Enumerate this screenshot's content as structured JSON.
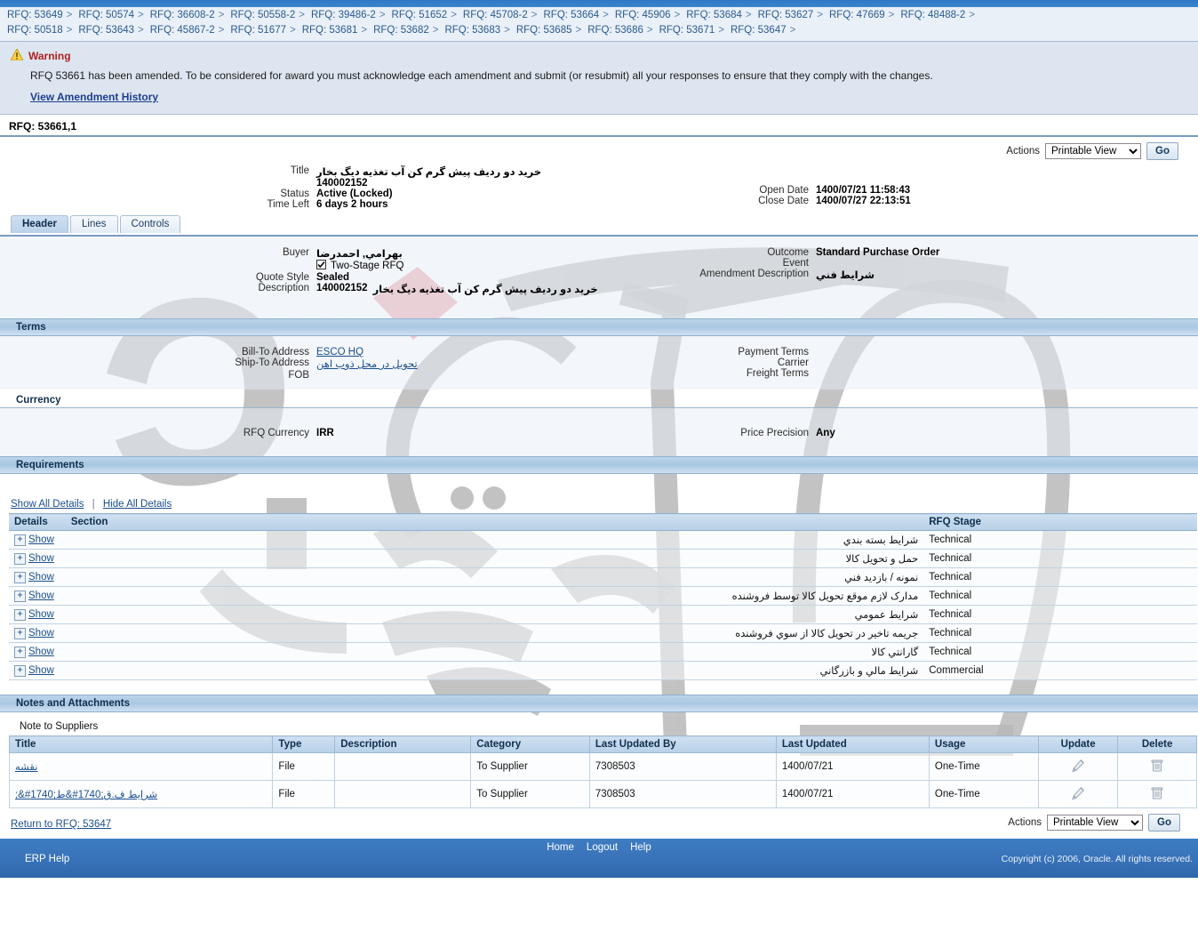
{
  "breadcrumb": {
    "row1": [
      "RFQ: 53649",
      "RFQ: 50574",
      "RFQ: 36608-2",
      "RFQ: 50558-2",
      "RFQ: 39486-2",
      "RFQ: 51652",
      "RFQ: 45708-2",
      "RFQ: 53664",
      "RFQ: 45906",
      "RFQ: 53684",
      "RFQ: 53627",
      "RFQ: 47669",
      "RFQ: 48488-2"
    ],
    "row2": [
      "RFQ: 50518",
      "RFQ: 53643",
      "RFQ: 45867-2",
      "RFQ: 51677",
      "RFQ: 53681",
      "RFQ: 53682",
      "RFQ: 53683",
      "RFQ: 53685",
      "RFQ: 53686",
      "RFQ: 53671",
      "RFQ: 53647"
    ],
    "separator": ">"
  },
  "warning": {
    "icon": "warning-triangle-icon",
    "title": "Warning",
    "message": "RFQ 53661 has been amended. To be considered for award you must acknowledge each amendment and submit (or resubmit) all your responses to ensure that they comply with the changes.",
    "link": "View Amendment History",
    "title_color": "#b02020"
  },
  "page": {
    "rfq_heading": "RFQ: 53661,1"
  },
  "actions_top": {
    "label": "Actions",
    "selected": "Printable View",
    "options": [
      "Printable View"
    ],
    "go": "Go"
  },
  "actions_bottom": {
    "label": "Actions",
    "selected": "Printable View",
    "options": [
      "Printable View"
    ],
    "go": "Go"
  },
  "summary": {
    "title_label": "Title",
    "title_value_ar": "خرید دو ردیف پیش گرم کن آب تغذیه دیگ بخار",
    "title_value_num": "140002152",
    "status_label": "Status",
    "status_value": "Active (Locked)",
    "time_left_label": "Time Left",
    "time_left_value": "6 days 2 hours",
    "open_date_label": "Open Date",
    "open_date_value": "1400/07/21 11:58:43",
    "close_date_label": "Close Date",
    "close_date_value": "1400/07/27 22:13:51"
  },
  "tabs": [
    {
      "label": "Header",
      "active": true
    },
    {
      "label": "Lines",
      "active": false
    },
    {
      "label": "Controls",
      "active": false
    }
  ],
  "header_section": {
    "buyer_label": "Buyer",
    "buyer_value": "بهرامي, احمدرضا",
    "two_stage_label": "Two-Stage RFQ",
    "two_stage_checked": true,
    "quote_style_label": "Quote Style",
    "quote_style_value": "Sealed",
    "description_label": "Description",
    "description_value_ar": "خرید دو ردیف پیش گرم کن آب تغذیه دیگ بخار",
    "description_value_num": "140002152",
    "outcome_label": "Outcome",
    "outcome_value": "Standard Purchase Order",
    "event_label": "Event",
    "event_value": "",
    "amendment_desc_label": "Amendment Description",
    "amendment_desc_value": "شرایط فني"
  },
  "terms": {
    "section_title": "Terms",
    "bill_to_label": "Bill-To Address",
    "bill_to_value": "ESCO HQ",
    "ship_to_label": "Ship-To Address",
    "ship_to_value": "تحویل در محل ذوب اهن",
    "fob_label": "FOB",
    "fob_value": "",
    "payment_terms_label": "Payment Terms",
    "payment_terms_value": "",
    "carrier_label": "Carrier",
    "carrier_value": "",
    "freight_terms_label": "Freight Terms",
    "freight_terms_value": ""
  },
  "currency": {
    "section_title": "Currency",
    "rfq_currency_label": "RFQ Currency",
    "rfq_currency_value": "IRR",
    "price_precision_label": "Price Precision",
    "price_precision_value": "Any"
  },
  "requirements": {
    "section_title": "Requirements",
    "show_all": "Show All Details",
    "hide_all": "Hide All Details",
    "columns": [
      "Details",
      "Section",
      "RFQ Stage"
    ],
    "show_label": "Show",
    "expand_glyph": "+",
    "rows": [
      {
        "section": "شرایط بسته بندي",
        "stage": "Technical"
      },
      {
        "section": "حمل و تحویل کالا",
        "stage": "Technical"
      },
      {
        "section": "نمونه / بازدید فني",
        "stage": "Technical"
      },
      {
        "section": "مدارک لازم موقع تحویل کالا توسط فروشنده",
        "stage": "Technical"
      },
      {
        "section": "شرایط عمومي",
        "stage": "Technical"
      },
      {
        "section": "جریمه تاخیر در تحویل کالا از سوي فروشنده",
        "stage": "Technical"
      },
      {
        "section": "گارانتي کالا",
        "stage": "Technical"
      },
      {
        "section": "شرایط مالي و بازرگاني",
        "stage": "Commercial"
      }
    ]
  },
  "notes": {
    "section_title": "Notes and Attachments",
    "note_to_suppliers_label": "Note to Suppliers",
    "columns": [
      "Title",
      "Type",
      "Description",
      "Category",
      "Last Updated By",
      "Last Updated",
      "Usage",
      "Update",
      "Delete"
    ],
    "rows": [
      {
        "title": "نقشه",
        "type": "File",
        "description": "",
        "category": "To Supplier",
        "last_updated_by": "7308503",
        "last_updated": "1400/07/21",
        "usage": "One-Time",
        "update_icon": "pencil-icon",
        "delete_icon": "trash-icon"
      },
      {
        "title": "شرایط ف.ق;1740#&ط;1740#&;",
        "type": "File",
        "description": "",
        "category": "To Supplier",
        "last_updated_by": "7308503",
        "last_updated": "1400/07/21",
        "usage": "One-Time",
        "update_icon": "pencil-icon",
        "delete_icon": "trash-icon"
      }
    ]
  },
  "return_link": "Return to RFQ: 53647",
  "footer": {
    "links": [
      "Home",
      "Logout",
      "Help"
    ],
    "erp_help": "ERP Help",
    "copyright": "Copyright (c) 2006, Oracle. All rights reserved.",
    "bg_color": "#3872b8"
  }
}
